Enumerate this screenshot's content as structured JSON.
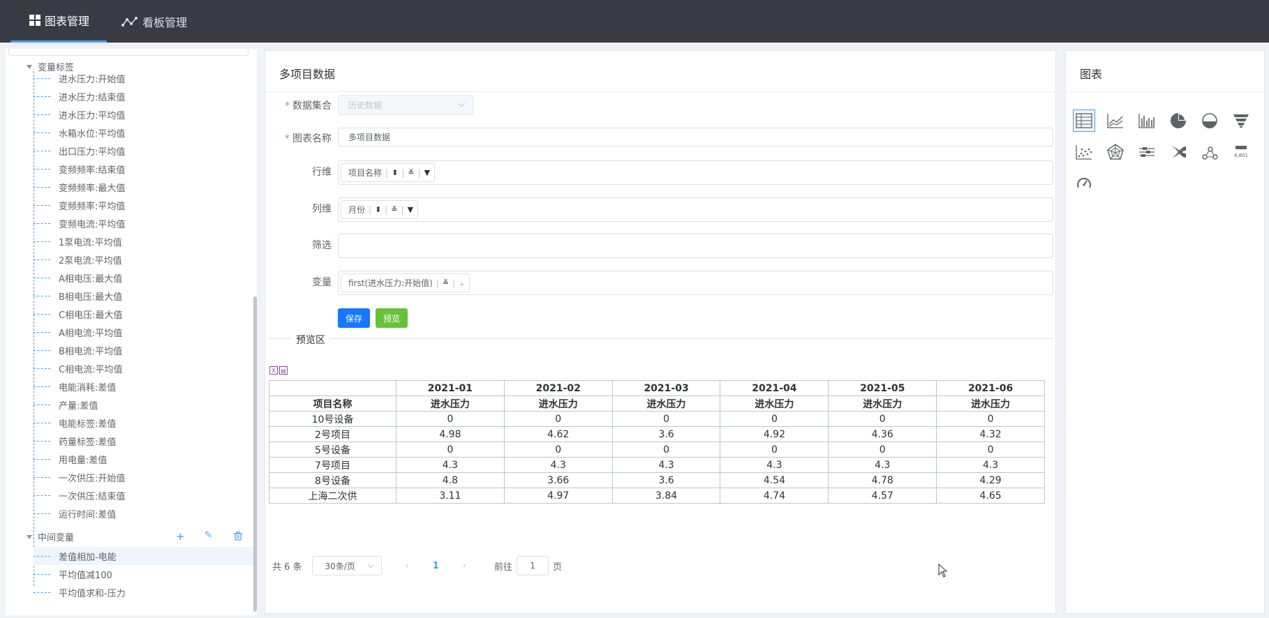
{
  "nav": {
    "tab1": "图表管理",
    "tab2": "看板管理"
  },
  "tree": {
    "group1": "变量标签",
    "group1_items": [
      "进水压力:开始值",
      "进水压力:结束值",
      "进水压力:平均值",
      "水箱水位:平均值",
      "出口压力:平均值",
      "变频频率:结束值",
      "变频频率:最大值",
      "变频频率:平均值",
      "变频电流:平均值",
      "1泵电流:平均值",
      "2泵电流:平均值",
      "A相电压:最大值",
      "B相电压:最大值",
      "C相电压:最大值",
      "A相电流:平均值",
      "B相电流:平均值",
      "C相电流:平均值",
      "电能消耗:差值",
      "产量:差值",
      "电能标签:差值",
      "药量标签:差值",
      "用电量:差值",
      "一次供压:开始值",
      "一次供压:结束值",
      "运行时间:差值"
    ],
    "group2": "中间变量",
    "group2_items": [
      "差值相加-电能",
      "平均值减100",
      "平均值求和-压力"
    ],
    "group2_actions": {
      "add": "+",
      "edit": "✎",
      "delete": "🗑"
    }
  },
  "form": {
    "title": "多项目数据",
    "dataset_label": "数据集合",
    "dataset_value": "历史数据",
    "chart_name_label": "图表名称",
    "chart_name_value": "多项目数据",
    "row_dim_label": "行维",
    "row_dim_chip": "项目名称",
    "col_dim_label": "列维",
    "col_dim_chip": "月份",
    "filter_label": "筛选",
    "variable_label": "变量",
    "variable_chip": "first(进水压力:开始值)",
    "save_label": "保存",
    "preview_label": "预览"
  },
  "preview": {
    "section_label": "预览区",
    "row_header": "项目名称",
    "months": [
      "2021-01",
      "2021-02",
      "2021-03",
      "2021-04",
      "2021-05",
      "2021-06"
    ],
    "metric": "进水压力",
    "rows": [
      {
        "name": "10号设备",
        "values": [
          "0",
          "0",
          "0",
          "0",
          "0",
          "0"
        ]
      },
      {
        "name": "2号项目",
        "values": [
          "4.98",
          "4.62",
          "3.6",
          "4.92",
          "4.36",
          "4.32"
        ]
      },
      {
        "name": "5号设备",
        "values": [
          "0",
          "0",
          "0",
          "0",
          "0",
          "0"
        ]
      },
      {
        "name": "7号项目",
        "values": [
          "4.3",
          "4.3",
          "4.3",
          "4.3",
          "4.3",
          "4.3"
        ]
      },
      {
        "name": "8号设备",
        "values": [
          "4.8",
          "3.66",
          "3.6",
          "4.54",
          "4.78",
          "4.29"
        ]
      },
      {
        "name": "上海二次供",
        "values": [
          "3.11",
          "4.97",
          "3.84",
          "4.74",
          "4.57",
          "4.65"
        ]
      }
    ]
  },
  "pager": {
    "total": "共 6 条",
    "page_size": "30条/页",
    "current_page": "1",
    "goto_prefix": "前往",
    "goto_value": "1",
    "goto_suffix": "页"
  },
  "charts_panel": {
    "title": "图表",
    "icons": [
      "table-icon",
      "line-chart-icon",
      "bar-chart-icon",
      "pie-chart-icon",
      "gauge-fill-icon",
      "funnel-icon",
      "scatter-icon",
      "radar-icon",
      "boxplot-icon",
      "sankey-icon",
      "graph-icon",
      "number-card-icon",
      "dashboard-icon"
    ],
    "number_card_text": "4,801"
  }
}
